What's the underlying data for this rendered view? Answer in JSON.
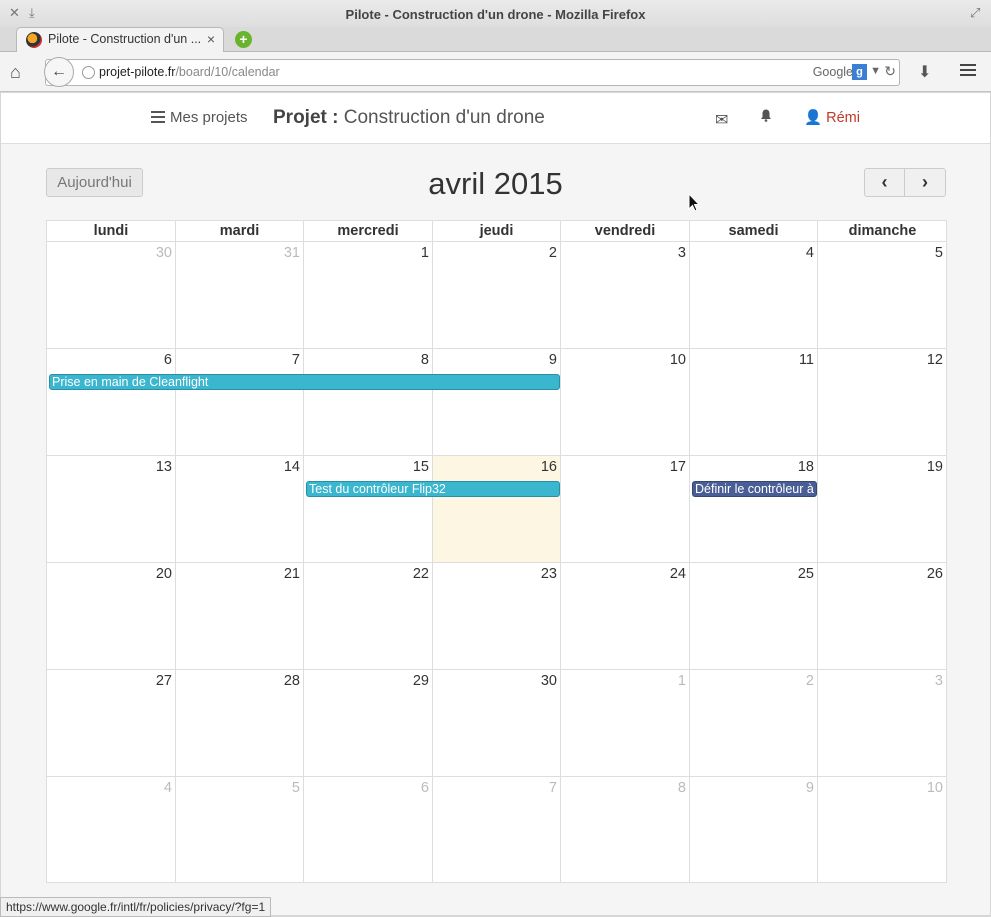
{
  "window": {
    "title": "Pilote - Construction d'un drone - Mozilla Firefox"
  },
  "tab": {
    "label": "Pilote - Construction d'un ...",
    "close": "×"
  },
  "nav": {
    "url_host": "projet-pilote.fr",
    "url_path": "/board/10/calendar",
    "search_engine": "Google",
    "search_badge": "g"
  },
  "app": {
    "my_projects": "Mes projets",
    "project_label": "Projet :",
    "project_name": "Construction d'un drone",
    "user": "Rémi"
  },
  "calendar": {
    "today_label": "Aujourd'hui",
    "month_title": "avril 2015",
    "weekdays": [
      "lundi",
      "mardi",
      "mercredi",
      "jeudi",
      "vendredi",
      "samedi",
      "dimanche"
    ],
    "weeks": [
      {
        "days": [
          {
            "n": "30",
            "other": true
          },
          {
            "n": "31",
            "other": true
          },
          {
            "n": "1"
          },
          {
            "n": "2"
          },
          {
            "n": "3"
          },
          {
            "n": "4"
          },
          {
            "n": "5"
          }
        ]
      },
      {
        "days": [
          {
            "n": "6"
          },
          {
            "n": "7"
          },
          {
            "n": "8"
          },
          {
            "n": "9"
          },
          {
            "n": "10"
          },
          {
            "n": "11"
          },
          {
            "n": "12"
          }
        ],
        "events": [
          {
            "title": "Prise en main de Cleanflight",
            "start": 0,
            "span": 4,
            "color": "cyan"
          }
        ]
      },
      {
        "days": [
          {
            "n": "13"
          },
          {
            "n": "14"
          },
          {
            "n": "15"
          },
          {
            "n": "16",
            "today": true
          },
          {
            "n": "17"
          },
          {
            "n": "18"
          },
          {
            "n": "19"
          }
        ],
        "events": [
          {
            "title": "Test du contrôleur Flip32",
            "start": 2,
            "span": 2,
            "color": "cyan"
          },
          {
            "title": "Définir le contrôleur à utiliser",
            "start": 5,
            "span": 1,
            "color": "navy"
          }
        ]
      },
      {
        "days": [
          {
            "n": "20"
          },
          {
            "n": "21"
          },
          {
            "n": "22"
          },
          {
            "n": "23"
          },
          {
            "n": "24"
          },
          {
            "n": "25"
          },
          {
            "n": "26"
          }
        ]
      },
      {
        "days": [
          {
            "n": "27"
          },
          {
            "n": "28"
          },
          {
            "n": "29"
          },
          {
            "n": "30"
          },
          {
            "n": "1",
            "other": true
          },
          {
            "n": "2",
            "other": true
          },
          {
            "n": "3",
            "other": true
          }
        ]
      },
      {
        "days": [
          {
            "n": "4",
            "other": true
          },
          {
            "n": "5",
            "other": true
          },
          {
            "n": "6",
            "other": true
          },
          {
            "n": "7",
            "other": true
          },
          {
            "n": "8",
            "other": true
          },
          {
            "n": "9",
            "other": true
          },
          {
            "n": "10",
            "other": true
          }
        ]
      }
    ]
  },
  "status_url": "https://www.google.fr/intl/fr/policies/privacy/?fg=1",
  "colors": {
    "event_cyan": "#3bb6cf",
    "event_navy": "#4a5e96",
    "user_red": "#c0392b",
    "today_bg": "#fcf6e3"
  }
}
